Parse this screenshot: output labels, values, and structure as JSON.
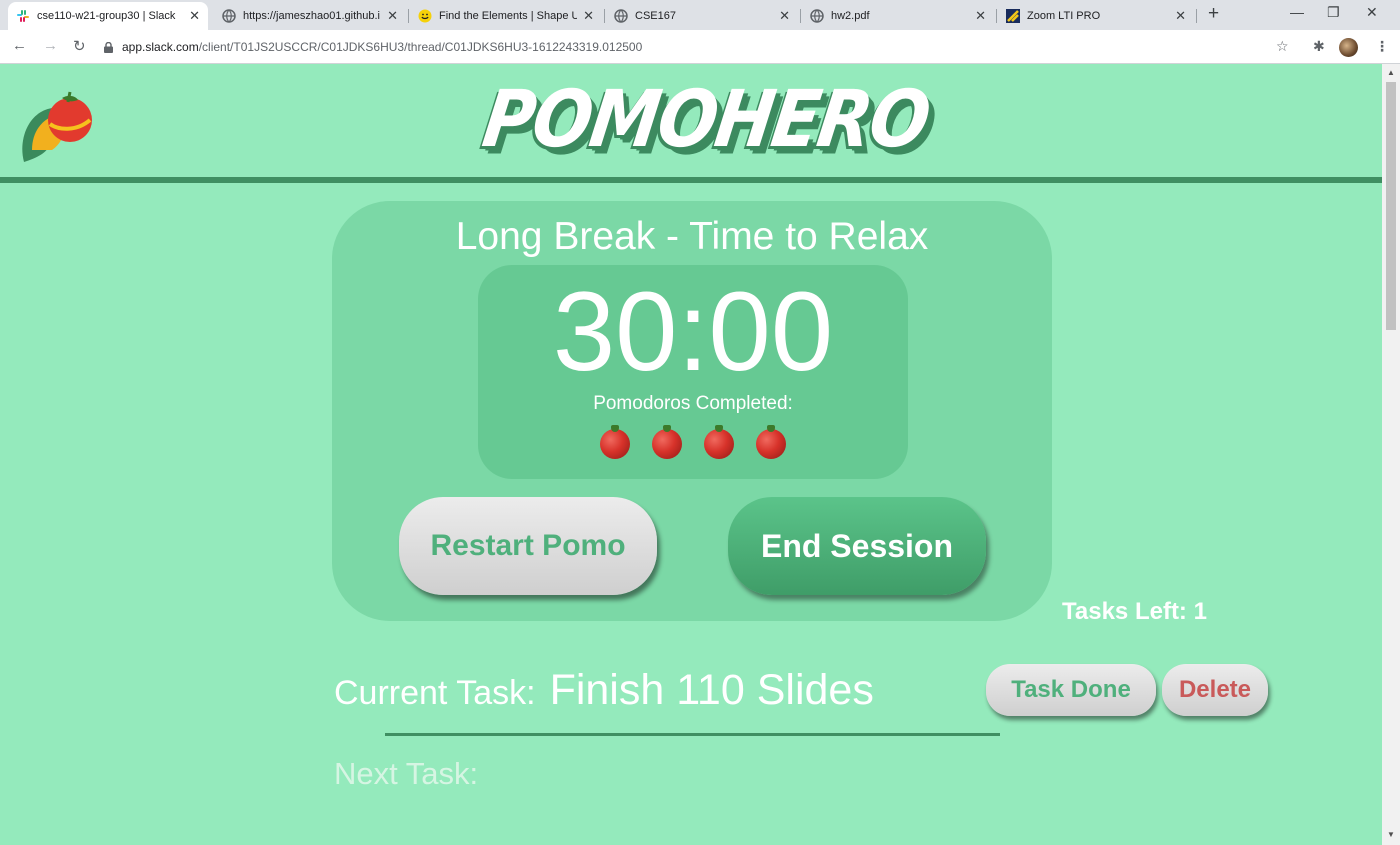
{
  "browser": {
    "tabs": [
      {
        "title": "cse110-w21-group30 | Slack",
        "icon": "slack-icon",
        "active": true
      },
      {
        "title": "https://jameszhao01.github.i",
        "icon": "globe-icon",
        "active": false
      },
      {
        "title": "Find the Elements | Shape Up",
        "icon": "shapeup-icon",
        "active": false
      },
      {
        "title": "CSE167",
        "icon": "globe-icon",
        "active": false
      },
      {
        "title": "hw2.pdf",
        "icon": "globe-icon",
        "active": false
      },
      {
        "title": "Zoom LTI PRO",
        "icon": "zoom-lti-icon",
        "active": false
      }
    ],
    "address": {
      "host": "app.slack.com",
      "path": "/client/T01JS2USCCR/C01JDKS6HU3/thread/C01JDKS6HU3-1612243319.012500"
    }
  },
  "app": {
    "brand": "POMOHERO",
    "mode_title": "Long Break - Time to Relax",
    "timer": "30:00",
    "pomodoros_label": "Pomodoros Completed:",
    "pomodoros_completed": 4,
    "restart_label": "Restart Pomo",
    "end_label": "End Session",
    "tasks_left": "Tasks Left: 1",
    "current_task_label": "Current Task:",
    "current_task": "Finish 110 Slides",
    "task_done_label": "Task Done",
    "delete_label": "Delete",
    "next_task_label": "Next Task:"
  },
  "colors": {
    "page_bg": "#94eabc",
    "card_bg": "#7bd8a6",
    "clock_bg": "#66c993",
    "accent_dark": "#3f8f62",
    "delete_red": "#c95a5a"
  }
}
